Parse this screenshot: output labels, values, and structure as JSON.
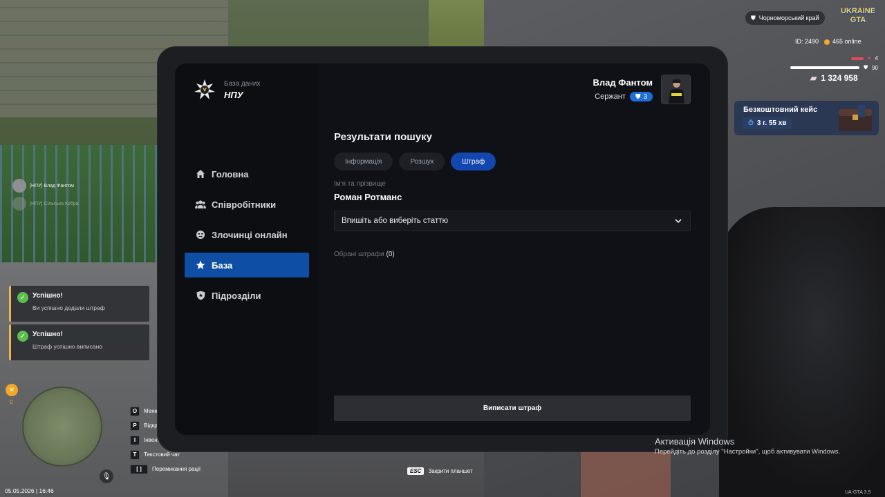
{
  "hud": {
    "server": "Чорноморський край",
    "logo": "UKRAINE GTA",
    "id": "ID: 2490",
    "online": "465 online",
    "bar1": "4",
    "bar2": "90",
    "money": "1 324 958",
    "case_title": "Безкоштовний кейс",
    "case_timer": "3 г. 55 хв",
    "food_count": "0",
    "datetime": "05.05.2026 | 16:46",
    "version": "UA-GTA 3.9",
    "player_names": [
      "[НПУ] Влад Фантом",
      "[НПУ] Сільська Кобра"
    ],
    "esc_key": "ESC",
    "esc_label": "Закрити планшет",
    "activation_title": "Активація Windows",
    "activation_text": "Перейдіть до розділу \"Настройки\", щоб активувати Windows.",
    "mic_key": "Я",
    "keys": [
      {
        "key": "O",
        "label": "Меню"
      },
      {
        "key": "P",
        "label": "Відкрити"
      },
      {
        "key": "I",
        "label": "Інвентар"
      },
      {
        "key": "T",
        "label": "Текстовий чат"
      },
      {
        "key": "[ ]",
        "label": "Перемикання рації"
      }
    ]
  },
  "toasts": [
    {
      "title": "Успішно!",
      "text": "Ви успішно додали штраф"
    },
    {
      "title": "Успішно!",
      "text": "Штраф успішно виписано"
    }
  ],
  "tablet": {
    "brand_sub": "База даних",
    "brand_title": "НПУ",
    "user_name": "Влад Фантом",
    "user_rank": "Сержант",
    "rank_level": "3",
    "nav": [
      {
        "label": "Головна",
        "icon": "home-icon",
        "active": false
      },
      {
        "label": "Співробітники",
        "icon": "users-icon",
        "active": false
      },
      {
        "label": "Злочинці онлайн",
        "icon": "criminal-icon",
        "active": false
      },
      {
        "label": "База",
        "icon": "star-icon",
        "active": true
      },
      {
        "label": "Підрозділи",
        "icon": "shield-icon",
        "active": false
      }
    ],
    "title": "Результати пошуку",
    "tabs": [
      {
        "label": "Інформація",
        "active": false
      },
      {
        "label": "Розшук",
        "active": false
      },
      {
        "label": "Штраф",
        "active": true
      }
    ],
    "field_label": "Ім'я та прізвище",
    "field_value": "Роман Ротманс",
    "select_placeholder": "Впишіть або виберіть статтю",
    "chosen_label": "Обрані штрафи",
    "chosen_count": "(0)",
    "submit_label": "Виписати штраф"
  },
  "colors": {
    "accent": "#0e4ea5",
    "tab_active": "#1446b0",
    "panel": "#0f1116"
  }
}
